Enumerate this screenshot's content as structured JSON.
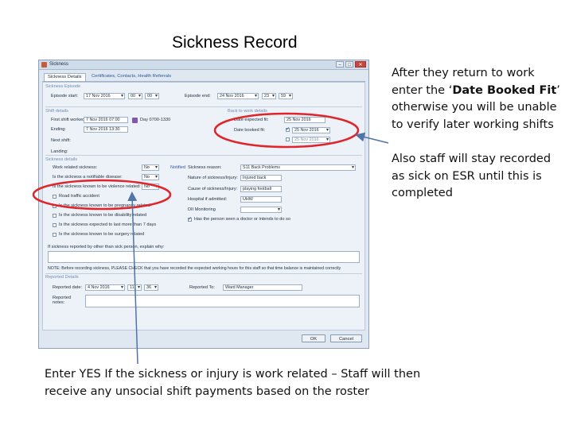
{
  "slide": {
    "title": "Sickness Record",
    "note_right_1": {
      "before": "After they return to work enter the ‘",
      "bold": "Date Booked Fit",
      "after": "’ otherwise you will be unable to verify later working shifts"
    },
    "note_right_2": "Also staff will stay recorded as sick on ESR until this is completed",
    "note_bottom": "Enter YES If the sickness or injury is work related – Staff will then receive any unsocial shift payments based on the roster"
  },
  "window": {
    "title": "Sickness",
    "tabs": [
      {
        "label": "Sickness Details"
      },
      {
        "label": "Certificates, Contacts, Health Referrals"
      }
    ],
    "episode_section": "Sickness Episode",
    "episode_start_label": "Episode start:",
    "episode_start_date": "17 Nov 2016",
    "episode_start_h": "00",
    "episode_start_m": "00",
    "episode_end_label": "Episode end:",
    "episode_end_date": "24 Nov 2016",
    "episode_end_h": "23",
    "episode_end_m": "59",
    "shift_section": "Shift details",
    "first_shift_label": "First shift worked:",
    "first_shift_value": "7 Nov 2016 07:00",
    "first_shift_code": "Day 0700-1330",
    "ending_label": "Ending:",
    "ending_value": "7 Nov 2016 13:30",
    "next_shift_label": "Next shift:",
    "landing_label": "Landing:",
    "back_section": "Back to work details",
    "date_expected_label": "Date expected fit:",
    "date_expected_value": "25 Nov 2016",
    "date_booked_label": "Date booked fit:",
    "date_booked_value": "25 Nov 2016",
    "date_booked_extra": "25 Nov 2016",
    "details_section": "Sickness details",
    "work_related_label": "Work related sickness:",
    "work_related_value": "No",
    "notifiable_label": "Is the sickness a notifiable disease:",
    "notifiable_value": "No",
    "violence_label": "Is the sickness known to be violence related:",
    "violence_value": "No",
    "notified_label": "Notified",
    "reason_label": "Sickness reason:",
    "reason_value": "S11 Back Problems",
    "nature_label": "Nature of sickness/Injury:",
    "nature_value": "Injured back",
    "cause_label": "Cause of sickness/Injury:",
    "cause_value": "playing football",
    "hospital_label": "Hospital if admitted:",
    "hospital_value": "UHW",
    "dii_label": "DII Monitoring",
    "checkboxes": [
      {
        "label": "Road traffic accident"
      },
      {
        "label": "Is the sickness known to be pregnancy related"
      },
      {
        "label": "Is the sickness known to be disability related"
      },
      {
        "label": "Is the sickness expected to last more than 7 days"
      },
      {
        "label": "Is the sickness known to be surgery related"
      }
    ],
    "doctor_label": "Has the person seen a doctor or intends to do so",
    "explain_label": "If sickness reported by other than sick person, explain why:",
    "note_label": "NOTE: Before recording sickness, PLEASE CHECK that you have recorded the expected working hours for this staff so that time balance is maintained correctly",
    "reported_section": "Reported Details",
    "reported_date_label": "Reported date:",
    "reported_date_value": "4 Nov 2016",
    "reported_h": "11",
    "reported_m": "36",
    "reported_to_label": "Reported To:",
    "reported_to_value": "Ward Manager",
    "reported_notes_label": "Reported notes:",
    "ok_label": "OK",
    "cancel_label": "Cancel"
  },
  "colors": {
    "highlight": "#e0242b",
    "arrow": "#4f74a8"
  }
}
